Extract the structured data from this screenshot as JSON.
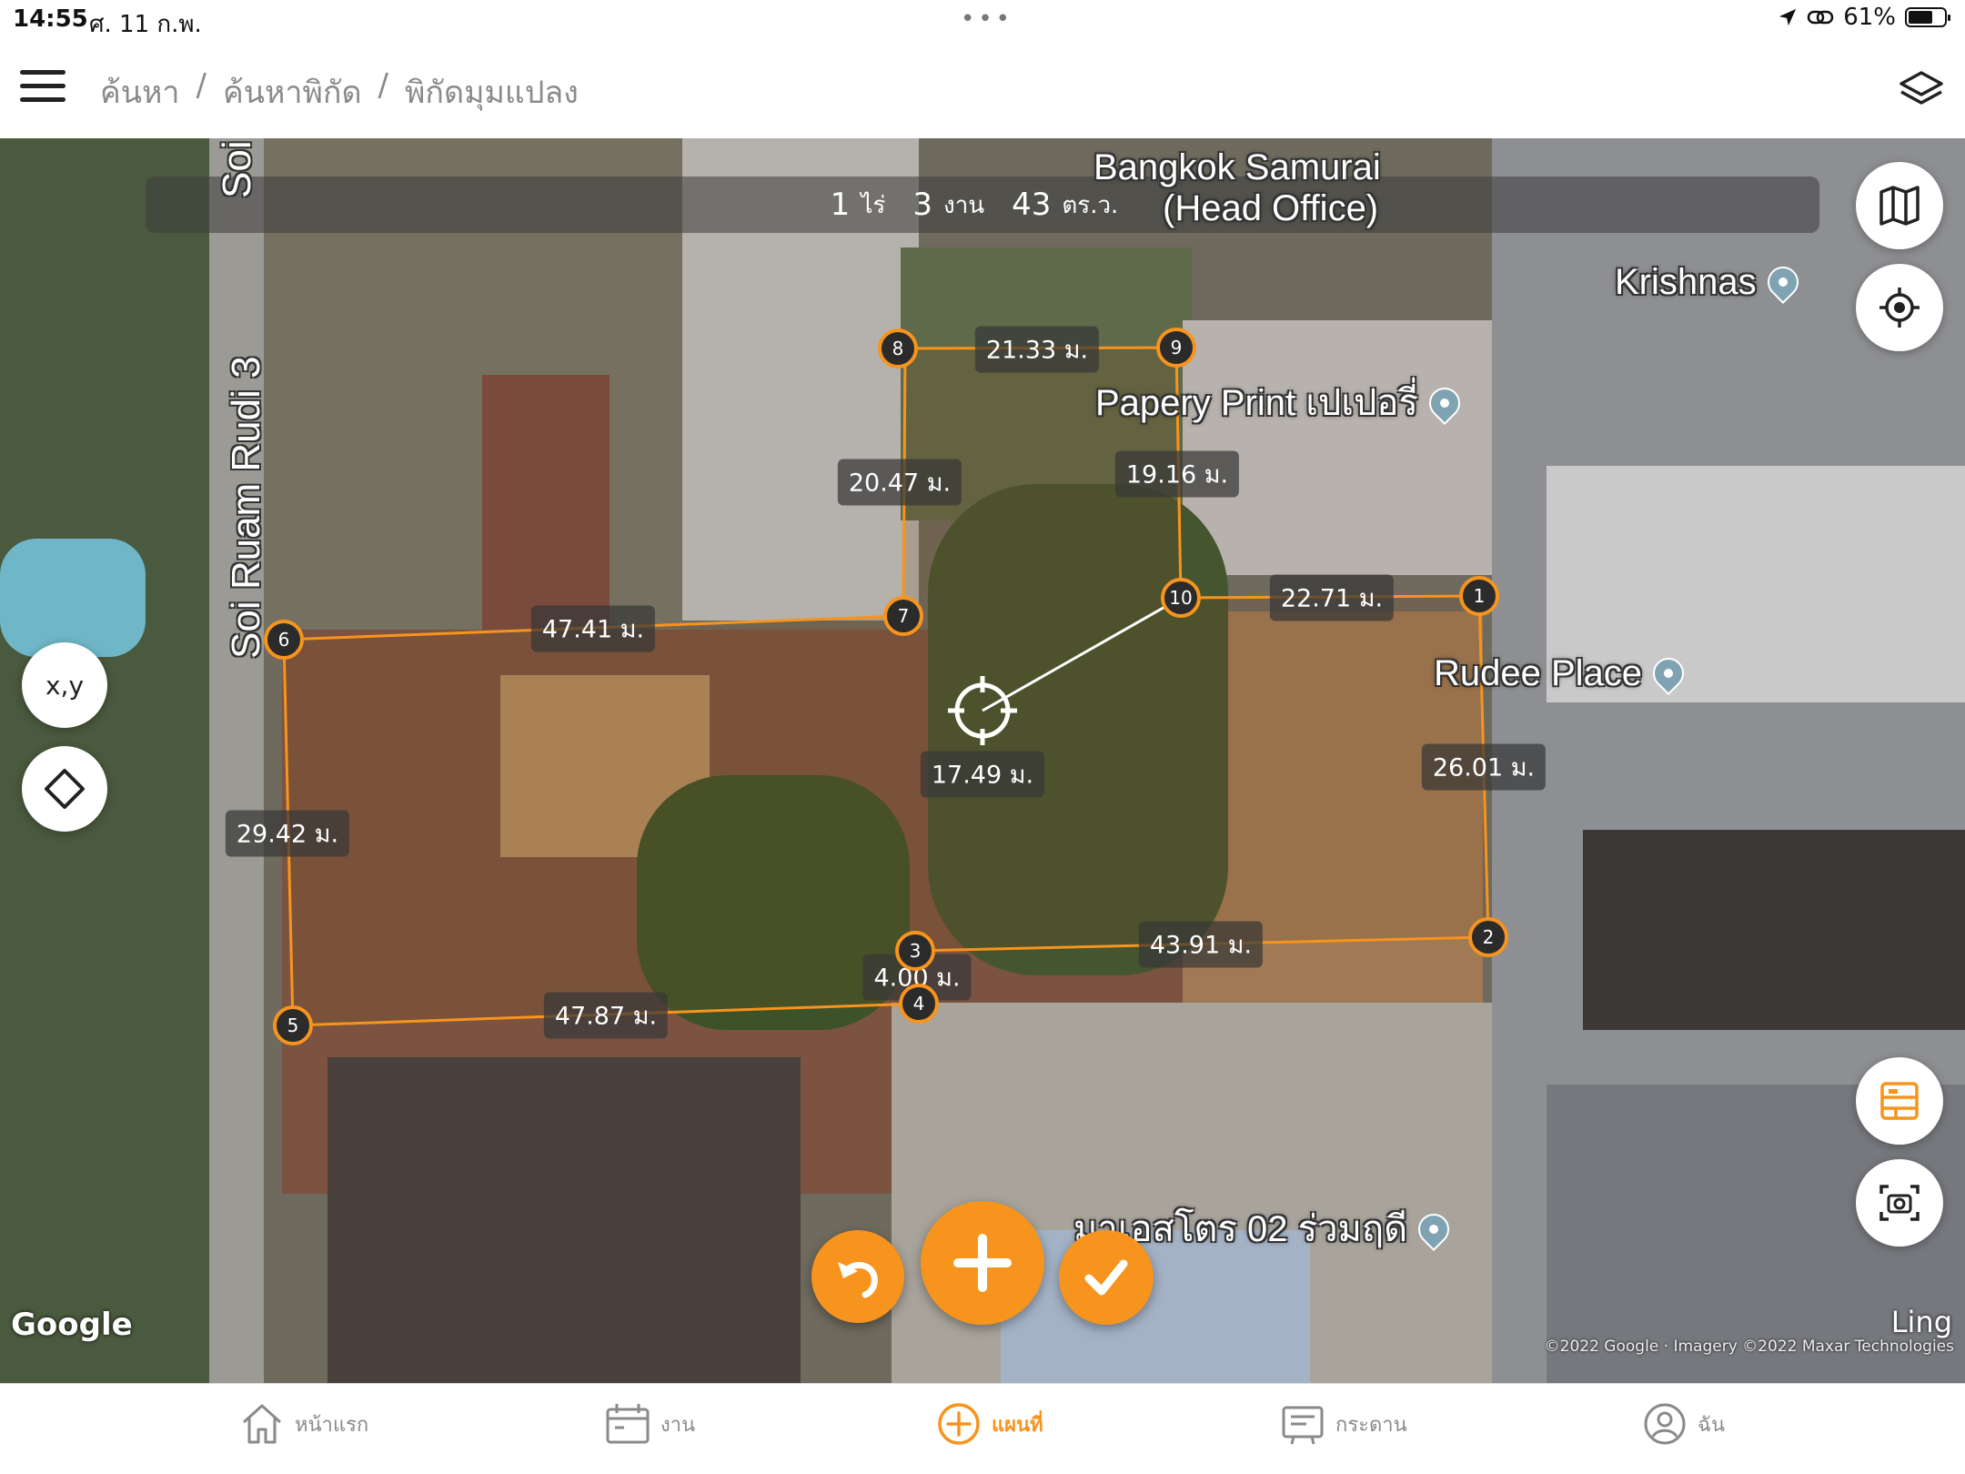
{
  "status_bar": {
    "time": "14:55",
    "date": "ศ. 11 ก.พ.",
    "battery": "61%"
  },
  "header": {
    "breadcrumb": [
      "ค้นหา",
      "ค้นหาพิกัด",
      "พิกัดมุมแปลง"
    ],
    "separator": "/"
  },
  "area": {
    "rai": "1",
    "rai_unit": "ไร่",
    "ngan": "3",
    "ngan_unit": "งาน",
    "wa": "43",
    "wa_unit": "ตร.ว."
  },
  "pois": {
    "bangkok_samurai_1": "Bangkok Samurai",
    "bangkok_samurai_2": "(Head Office)",
    "krishnas": "Krishnas",
    "papery": "Papery Print เปเปอรี่",
    "rudee": "Rudee Place",
    "mass_store": "มาเอสโตร 02 ร่วมฤดี",
    "street_1": "Soi Ruam Rudi 3",
    "street_2": "Soi"
  },
  "segments": {
    "s1_2": "26.01 ม.",
    "s2_3": "43.91 ม.",
    "s3_4": "4.00 ม.",
    "s4_5": "47.87 ม.",
    "s5_6": "29.42 ม.",
    "s6_7": "47.41 ม.",
    "s7_8": "20.47 ม.",
    "s8_9": "21.33 ม.",
    "s9_10": "19.16 ม.",
    "s10_1": "22.71 ม.",
    "cursor": "17.49 ม."
  },
  "vertices": [
    "1",
    "2",
    "3",
    "4",
    "5",
    "6",
    "7",
    "8",
    "9",
    "10"
  ],
  "buttons": {
    "xy": "x,y"
  },
  "map_attribution": {
    "google": "Google",
    "ling": "Ling",
    "copyright": "©2022 Google · Imagery ©2022 Maxar Technologies"
  },
  "tabs": [
    {
      "label": "หน้าแรก",
      "icon": "home-icon"
    },
    {
      "label": "งาน",
      "icon": "calendar-icon"
    },
    {
      "label": "แผนที่",
      "icon": "plus-circle-icon",
      "active": true
    },
    {
      "label": "กระดาน",
      "icon": "board-icon"
    },
    {
      "label": "ฉัน",
      "icon": "profile-icon"
    }
  ],
  "colors": {
    "accent": "#f7941d",
    "inactive": "#8a8a8a"
  }
}
